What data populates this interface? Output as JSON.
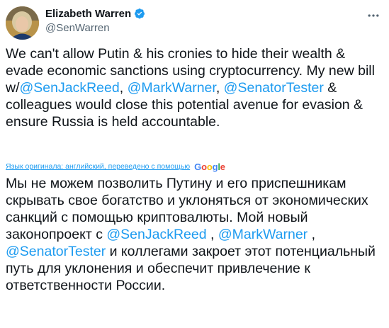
{
  "author": {
    "name": "Elizabeth Warren",
    "handle": "@SenWarren"
  },
  "icons": {
    "verified": "verified-badge-icon",
    "more": "more-options-icon"
  },
  "original": {
    "p1": "We can't allow Putin & his cronies to hide their wealth & evade economic sanctions using cryptocurrency. My new bill w/",
    "m1": "@SenJackReed",
    "p2": ", ",
    "m2": "@MarkWarner",
    "p3": ", ",
    "m3": "@SenatorTester",
    "p4": " & colleagues would close this potential avenue for evasion & ensure Russia is held accountable."
  },
  "translation_notice": {
    "label": "Язык оригинала: английский, переведено с помощью",
    "provider_letters": [
      "G",
      "o",
      "o",
      "g",
      "l",
      "e"
    ]
  },
  "translated": {
    "p1": "Мы не можем позволить Путину и его приспешникам скрывать свое богатство и уклоняться от экономических санкций с помощью криптовалюты. Мой новый законопроект с ",
    "m1": "@SenJackReed",
    "p2": " , ",
    "m2": "@MarkWarner",
    "p3": " , ",
    "m3": "@SenatorTester",
    "p4": " и коллегами закроет этот потенциальный путь для уклонения и обеспечит привлечение к ответственности России."
  },
  "colors": {
    "link": "#1d9bf0",
    "text": "#0f1419",
    "secondary": "#536471"
  }
}
